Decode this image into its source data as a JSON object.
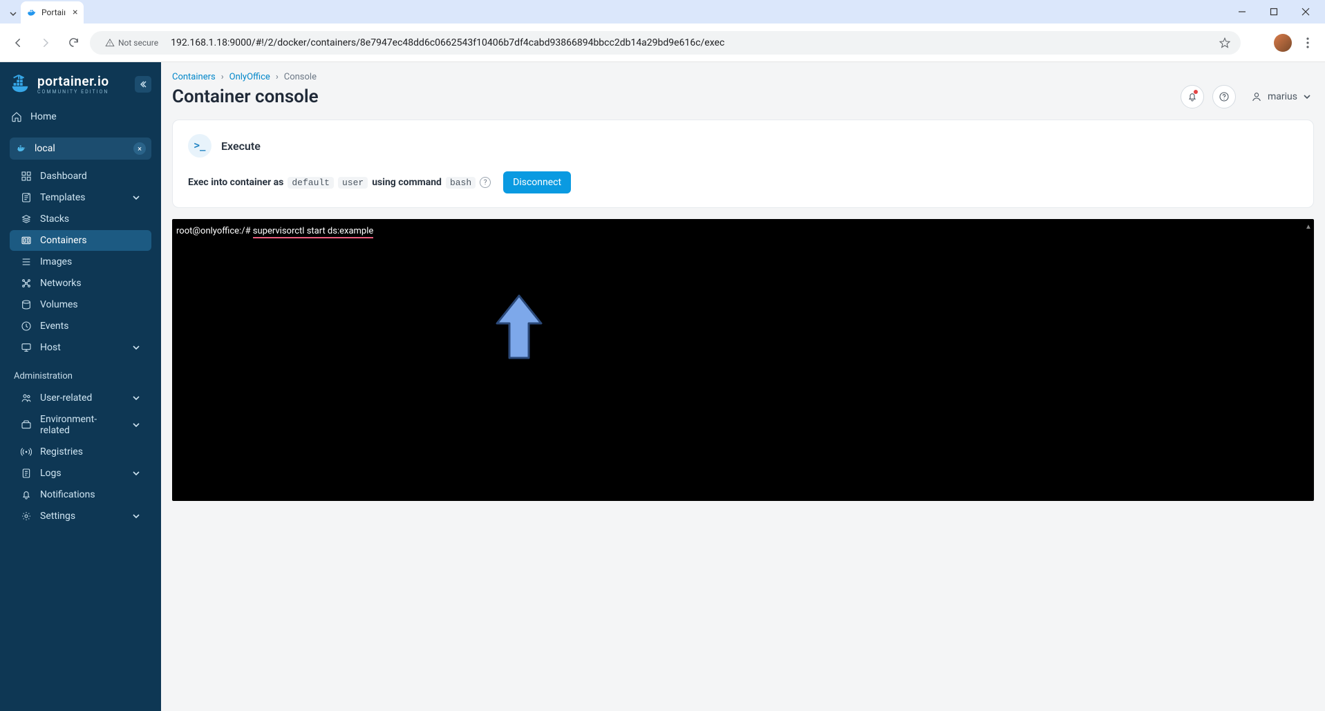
{
  "browser": {
    "tab_title": "Portaiı",
    "url": "192.168.1.18:9000/#!/2/docker/containers/8e7947ec48dd6c0662543f10406b7df4cabd93866894bbcc2db14a29bd9e616c/exec",
    "not_secure": "Not secure"
  },
  "logo": {
    "name": "portainer.io",
    "edition": "COMMUNITY EDITION"
  },
  "sidebar": {
    "home": "Home",
    "env_label": "local",
    "items": [
      {
        "icon": "dashboard",
        "label": "Dashboard"
      },
      {
        "icon": "templates",
        "label": "Templates",
        "chev": true
      },
      {
        "icon": "stacks",
        "label": "Stacks"
      },
      {
        "icon": "containers",
        "label": "Containers",
        "active": true
      },
      {
        "icon": "images",
        "label": "Images"
      },
      {
        "icon": "networks",
        "label": "Networks"
      },
      {
        "icon": "volumes",
        "label": "Volumes"
      },
      {
        "icon": "events",
        "label": "Events"
      },
      {
        "icon": "host",
        "label": "Host",
        "chev": true
      }
    ],
    "admin_label": "Administration",
    "admin_items": [
      {
        "icon": "users",
        "label": "User-related",
        "chev": true
      },
      {
        "icon": "env",
        "label": "Environment-related",
        "chev": true
      },
      {
        "icon": "radio",
        "label": "Registries"
      },
      {
        "icon": "logs",
        "label": "Logs",
        "chev": true
      },
      {
        "icon": "bell",
        "label": "Notifications"
      },
      {
        "icon": "gear",
        "label": "Settings",
        "chev": true
      }
    ]
  },
  "breadcrumbs": {
    "a": "Containers",
    "b": "OnlyOffice",
    "c": "Console"
  },
  "page_title": "Container console",
  "user_name": "marius",
  "execute": {
    "title": "Execute",
    "prefix": "Exec into container as",
    "user": "default",
    "user2": "user",
    "mid": "using command",
    "cmd": "bash",
    "disconnect": "Disconnect"
  },
  "terminal": {
    "prompt": "root@onlyoffice:/# ",
    "command": "supervisorctl start ds:example"
  }
}
